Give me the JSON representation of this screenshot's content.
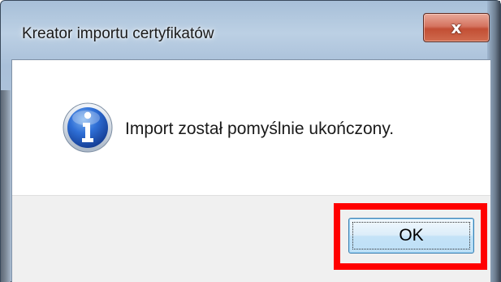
{
  "window": {
    "title": "Kreator importu certyfikatów",
    "close_glyph": "x"
  },
  "message": {
    "icon": "info-icon",
    "text": "Import został pomyślnie ukończony."
  },
  "buttons": {
    "ok_label": "OK"
  },
  "colors": {
    "highlight": "#ff0000",
    "close_button": "#c24e34",
    "ok_border": "#3c7fb1"
  }
}
